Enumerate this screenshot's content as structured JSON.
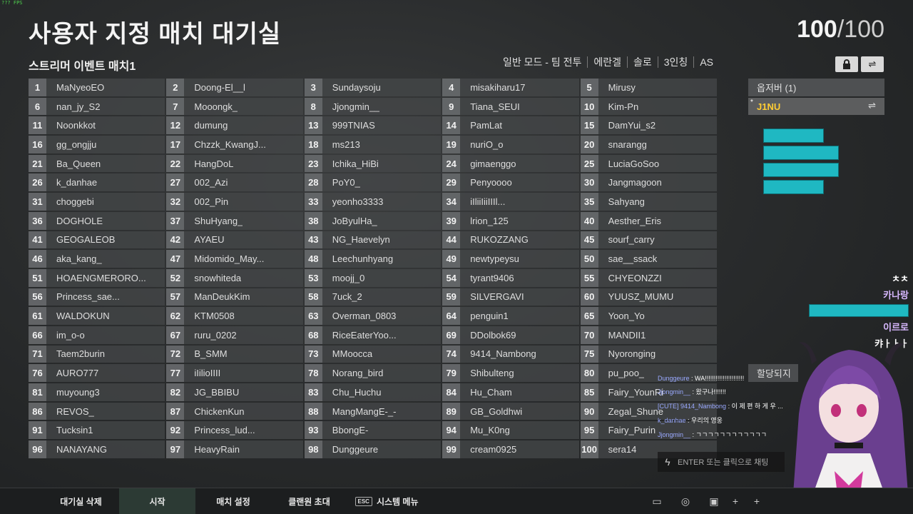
{
  "fps": "??? FPS",
  "title": "사용자 지정 매치 대기실",
  "count": {
    "current": "100",
    "total": "/100"
  },
  "match_name": "스트리머 이벤트 매치1",
  "settings": [
    "일반 모드 - 팀 전투",
    "에란겔",
    "솔로",
    "3인칭",
    "AS"
  ],
  "icons": {
    "lock": "lock-icon",
    "swap": "swap-icon"
  },
  "players": [
    "MaNyeoEO",
    "Doong-El__l",
    "Sundaysoju",
    "misakiharu17",
    "Mirusy",
    "nan_jy_S2",
    "Mooongk_",
    "Jjongmin__",
    "Tiana_SEUI",
    "Kim-Pn",
    "Noonkkot",
    "dumung",
    "999TNIAS",
    "PamLat",
    "DamYui_s2",
    "gg_ongjju",
    "Chzzk_KwangJ...",
    "ms213",
    "nuriO_o",
    "snarangg",
    "Ba_Queen",
    "HangDoL",
    "Ichika_HiBi",
    "gimaenggo",
    "LuciaGoSoo",
    "k_danhae",
    "002_Azi",
    "PoY0_",
    "Penyoooo",
    "Jangmagoon",
    "choggebi",
    "002_Pin",
    "yeonho3333",
    "iIliiIiiIIIl...",
    "Sahyang",
    "DOGHOLE",
    "ShuHyang_",
    "JoByulHa_",
    "lrion_125",
    "Aesther_Eris",
    "GEOGALEOB",
    "AYAEU",
    "NG_Haevelyn",
    "RUKOZZANG",
    "sourf_carry",
    "aka_kang_",
    "Midomido_May...",
    "Leechunhyang",
    "newtypeysu",
    "sae__ssack",
    "HOAENGMERORO...",
    "snowhiteda",
    "moojj_0",
    "tyrant9406",
    "CHYEONZZI",
    "Princess_sae...",
    "ManDeukKim",
    "7uck_2",
    "SILVERGAVI",
    "YUUSZ_MUMU",
    "WALDOKUN",
    "KTM0508",
    "Overman_0803",
    "penguin1",
    "Yoon_Yo",
    "im_o-o",
    "ruru_0202",
    "RiceEaterYoo...",
    "DDolbok69",
    "MANDII1",
    "Taem2burin",
    "B_SMM",
    "MMoocca",
    "9414_Nambong",
    "Nyoronging",
    "AURO777",
    "iIilioIIII",
    "Norang_bird",
    "Shibulteng",
    "pu_poo_",
    "muyoung3",
    "JG_BBIBU",
    "Chu_Huchu",
    "Hu_Cham",
    "Fairy_YounRi",
    "REVOS_",
    "ChickenKun",
    "MangMangE-_-",
    "GB_Goldhwi",
    "Zegal_Shune",
    "Tucksin1",
    "Princess_lud...",
    "BbongE-",
    "Mu_K0ng",
    "Fairy_Purin",
    "NANAYANG",
    "HeavyRain",
    "Dunggeure",
    "cream0925",
    "sera14"
  ],
  "observers": {
    "header": "옵저버 (1)",
    "name": "J1NU",
    "star": "*"
  },
  "assign_label": "할당되지",
  "side_chat": [
    "ㅊㅊ",
    "카나랑",
    "이르로",
    "캬ㅏㅏㅏ"
  ],
  "chat": [
    {
      "who": "Dunggeure",
      "msg": " : WA!!!!!!!!!!!!!!!!!!!!!!"
    },
    {
      "who": "Jjongmin__",
      "msg": " : 왔구나!!!!!!!"
    },
    {
      "who": "[CUTE] 9414_Nambong",
      "msg": " : 이 제 편 하 게 우 ..."
    },
    {
      "who": "k_danhae",
      "msg": " : 우리의 영웅"
    },
    {
      "who": "Jjongmin__",
      "msg": " : ㄱㄱㄱㄱㄱㄱㄱㄱㄱㄱㄱㄱ"
    }
  ],
  "chat_input_placeholder": "ENTER 또는 클릭으로 채팅",
  "bottom_tabs": [
    "대기실 삭제",
    "시작",
    "매치 설정",
    "클랜원 초대",
    "시스템 메뉴"
  ],
  "esc_key": "ESC",
  "colors": {
    "observer_name": "#ffcc33",
    "accent_teal": "#1fb8c2",
    "active_tab": "#2c3a34"
  }
}
